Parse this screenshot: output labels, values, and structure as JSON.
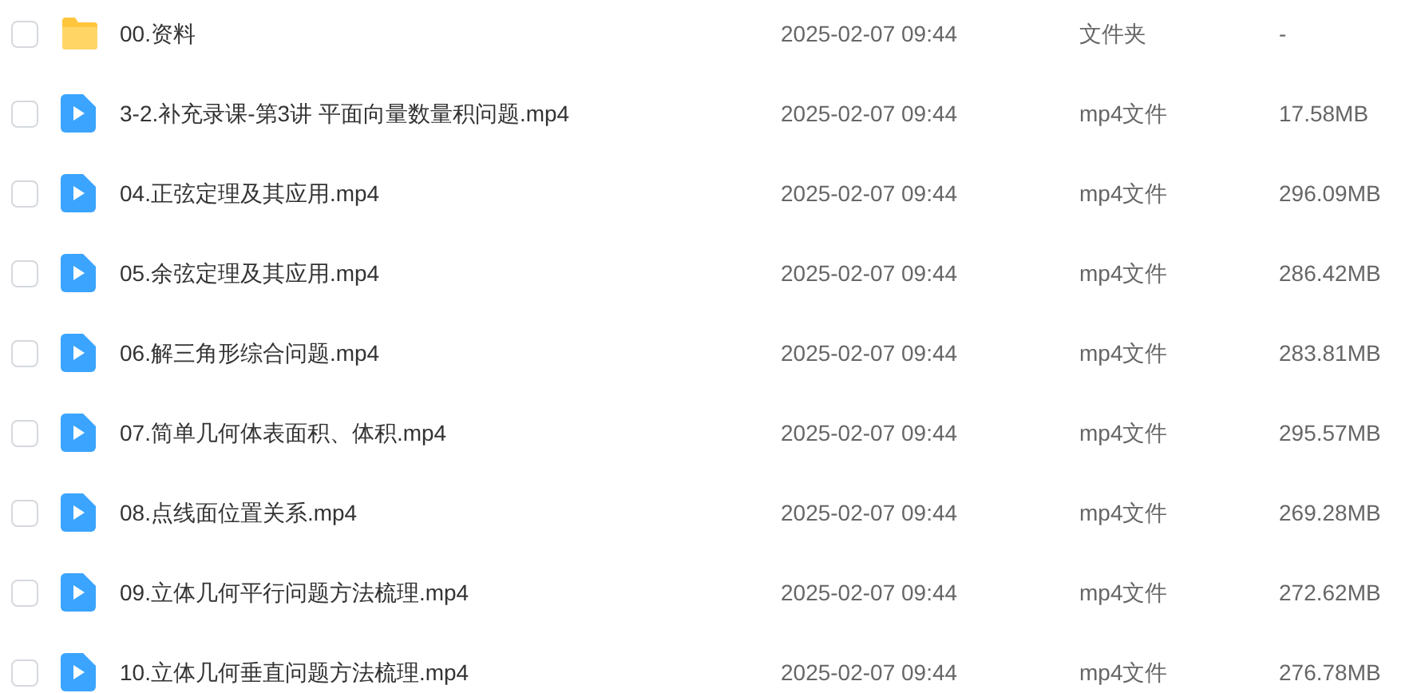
{
  "files": [
    {
      "kind": "folder",
      "checked": false,
      "name": "00.资料",
      "modified": "2025-02-07 09:44",
      "type": "文件夹",
      "size": "-"
    },
    {
      "kind": "video",
      "checked": false,
      "name": "3-2.补充录课-第3讲 平面向量数量积问题.mp4",
      "modified": "2025-02-07 09:44",
      "type": "mp4文件",
      "size": "17.58MB"
    },
    {
      "kind": "video",
      "checked": false,
      "name": "04.正弦定理及其应用.mp4",
      "modified": "2025-02-07 09:44",
      "type": "mp4文件",
      "size": "296.09MB"
    },
    {
      "kind": "video",
      "checked": false,
      "name": "05.余弦定理及其应用.mp4",
      "modified": "2025-02-07 09:44",
      "type": "mp4文件",
      "size": "286.42MB"
    },
    {
      "kind": "video",
      "checked": false,
      "name": "06.解三角形综合问题.mp4",
      "modified": "2025-02-07 09:44",
      "type": "mp4文件",
      "size": "283.81MB"
    },
    {
      "kind": "video",
      "checked": false,
      "name": "07.简单几何体表面积、体积.mp4",
      "modified": "2025-02-07 09:44",
      "type": "mp4文件",
      "size": "295.57MB"
    },
    {
      "kind": "video",
      "checked": false,
      "name": "08.点线面位置关系.mp4",
      "modified": "2025-02-07 09:44",
      "type": "mp4文件",
      "size": "269.28MB"
    },
    {
      "kind": "video",
      "checked": false,
      "name": "09.立体几何平行问题方法梳理.mp4",
      "modified": "2025-02-07 09:44",
      "type": "mp4文件",
      "size": "272.62MB"
    },
    {
      "kind": "video",
      "checked": false,
      "name": "10.立体几何垂直问题方法梳理.mp4",
      "modified": "2025-02-07 09:44",
      "type": "mp4文件",
      "size": "276.78MB"
    }
  ]
}
